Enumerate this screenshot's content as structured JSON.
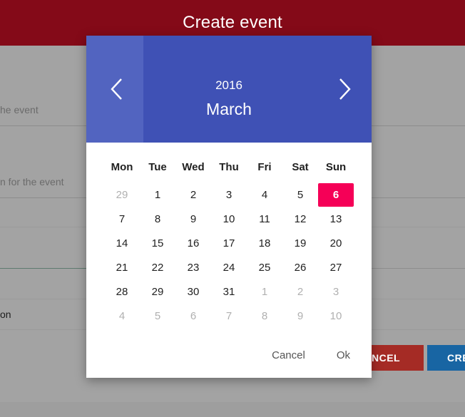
{
  "app": {
    "title": "Create event"
  },
  "background": {
    "field1_label_partial": "he event",
    "field2_label_partial": "n for the event",
    "field3_value_partial": "on",
    "cancel_button_partial": "NCEL",
    "create_button_partial": "CRE"
  },
  "calendar": {
    "year": "2016",
    "month": "March",
    "weekdays": [
      "Mon",
      "Tue",
      "Wed",
      "Thu",
      "Fri",
      "Sat",
      "Sun"
    ],
    "weeks": [
      [
        {
          "d": "29",
          "m": true
        },
        {
          "d": "1"
        },
        {
          "d": "2"
        },
        {
          "d": "3"
        },
        {
          "d": "4"
        },
        {
          "d": "5"
        },
        {
          "d": "6",
          "s": true
        }
      ],
      [
        {
          "d": "7"
        },
        {
          "d": "8"
        },
        {
          "d": "9"
        },
        {
          "d": "10"
        },
        {
          "d": "11"
        },
        {
          "d": "12"
        },
        {
          "d": "13"
        }
      ],
      [
        {
          "d": "14"
        },
        {
          "d": "15"
        },
        {
          "d": "16"
        },
        {
          "d": "17"
        },
        {
          "d": "18"
        },
        {
          "d": "19"
        },
        {
          "d": "20"
        }
      ],
      [
        {
          "d": "21"
        },
        {
          "d": "22"
        },
        {
          "d": "23"
        },
        {
          "d": "24"
        },
        {
          "d": "25"
        },
        {
          "d": "26"
        },
        {
          "d": "27"
        }
      ],
      [
        {
          "d": "28"
        },
        {
          "d": "29"
        },
        {
          "d": "30"
        },
        {
          "d": "31"
        },
        {
          "d": "1",
          "m": true
        },
        {
          "d": "2",
          "m": true
        },
        {
          "d": "3",
          "m": true
        }
      ],
      [
        {
          "d": "4",
          "m": true
        },
        {
          "d": "5",
          "m": true
        },
        {
          "d": "6",
          "m": true
        },
        {
          "d": "7",
          "m": true
        },
        {
          "d": "8",
          "m": true
        },
        {
          "d": "9",
          "m": true
        },
        {
          "d": "10",
          "m": true
        }
      ]
    ],
    "cancel_label": "Cancel",
    "ok_label": "Ok"
  },
  "icons": {
    "prev": "chevron-left-icon",
    "next": "chevron-right-icon"
  },
  "colors": {
    "app_bar": "#840a18",
    "header": "#3f51b5",
    "selected_day": "#f50057"
  }
}
